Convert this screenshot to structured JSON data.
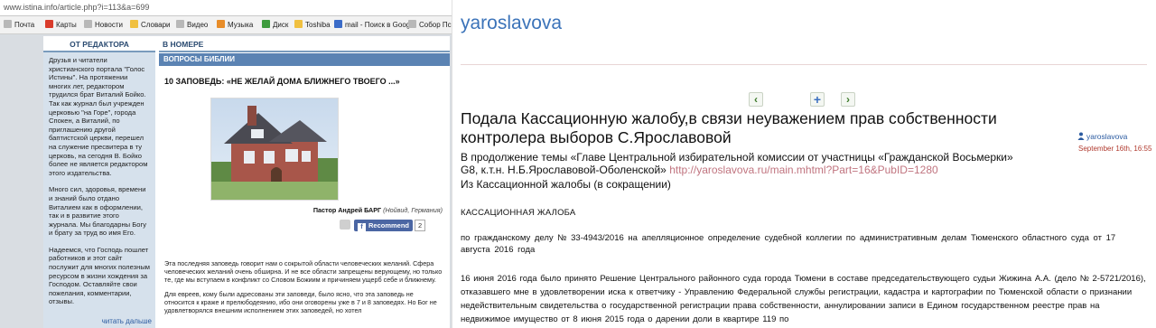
{
  "left_browser": {
    "url": "www.istina.info/article.php?i=113&a=699",
    "bookmarks": [
      {
        "label": "Почта",
        "icon": "mail-icon"
      },
      {
        "label": "Карты",
        "icon": "map-icon"
      },
      {
        "label": "Новости",
        "icon": "news-icon"
      },
      {
        "label": "Словари",
        "icon": "dictionary-icon"
      },
      {
        "label": "Видео",
        "icon": "video-icon"
      },
      {
        "label": "Музыка",
        "icon": "music-icon"
      },
      {
        "label": "Диск",
        "icon": "disk-icon"
      },
      {
        "label": "Toshiba",
        "icon": "folder-icon"
      },
      {
        "label": "mail - Поиск в Googl",
        "icon": "google-icon"
      },
      {
        "label": "Собор Псков",
        "icon": "page-icon"
      }
    ],
    "editor_column": {
      "heading": "ОТ РЕДАКТОРА",
      "paragraphs": [
        "Друзья и читатели христианского портала \"Голос Истины\". На протяжении многих лет, редактором трудился брат Виталий Бойко. Так как журнал был учрежден церковью \"на Горе\", города Спокен, а Виталий, по приглашению другой баптистской церкви, перешел на служение пресвитера в ту церковь, на сегодня В. Бойко более не является редактором этого издательства.",
        "Много сил, здоровья, времени и знаний было отдано Виталием как в оформлении, так и в развитие этого журнала. Мы благодарны Богу и брату за труд во имя Его.",
        "Надеемся, что Господь пошлет работников и этот сайт послужит для многих полезным ресурсом в жизни хождения за Господом. Оставляйте свои пожелания, комментарии, отзывы."
      ],
      "more_link": "читать дальше"
    },
    "issue_column": {
      "heading": "В НОМЕРЕ",
      "section": "ВОПРОСЫ БИБЛИИ",
      "article_title": "10 ЗАПОВЕДЬ: «НЕ ЖЕЛАЙ ДОМА БЛИЖНЕГО ТВОЕГО ...»",
      "caption_author": "Пастор Андрей БАРГ",
      "caption_place": "(Нойвид, Германия)",
      "recommend_label": "Recommend",
      "recommend_count": "2",
      "body": [
        "Эта последняя заповедь говорит нам о сокрытой области человеческих желаний. Сфера человеческих желаний очень обширна. И не все области запрещены верующему, но только те, где мы вступаем в конфликт со Словом Божиим и причиняем ущерб себе и ближнему.",
        "Для евреев, кому были адресованы эти заповеди, было ясно, что эта заповедь не относится к краже и прелюбодеянию, ибо они оговорены уже в 7 и 8 заповедях. Но Бог не удовлетворялся внешним исполнением этих заповедей, но хотел"
      ]
    }
  },
  "blog": {
    "name": "yaroslavova",
    "nav": {
      "prev": "‹",
      "add": "+",
      "next": "›"
    },
    "post_title": "Подала Кассационную жалобу,в связи неуважением прав собственности контролера выборов С.Ярославовой",
    "author": "yaroslavova",
    "date": "September 16th, 16:55",
    "intro_text": "В продолжение темы «Главе Центральной избирательной комиссии от участницы «Гражданской Восьмерки» G8, к.т.н. Н.Б.Ярославовой-Оболенской»",
    "intro_link": "http://yaroslavova.ru/main.mhtml?Part=16&PubID=1280",
    "intro_line3": "Из Кассационной жалобы (в сокращении)",
    "complaint_caption": "КАССАЦИОННАЯ ЖАЛОБА",
    "case_line": "по гражданскому делу № 33-4943/2016 на апелляционное определение судебной коллегии по административным делам Тюменского областного суда от 17 августа 2016 года",
    "paragraph": "16 июня 2016 года было принято Решение Центрального районного суда города Тюмени в составе председательствующего судьи Жижина А.А. (дело № 2-5721/2016), отказавшего мне в удовлетворении иска к ответчику - Управлению Федеральной службы регистрации, кадастра и картографии по Тюменской области о признании недействительным свидетельства о государственной регистрации права собственности, аннулировании записи в Едином государственном реестре прав на недвижимое имущество от 8 июня 2015 года о дарении доли в квартире 119 по"
  }
}
